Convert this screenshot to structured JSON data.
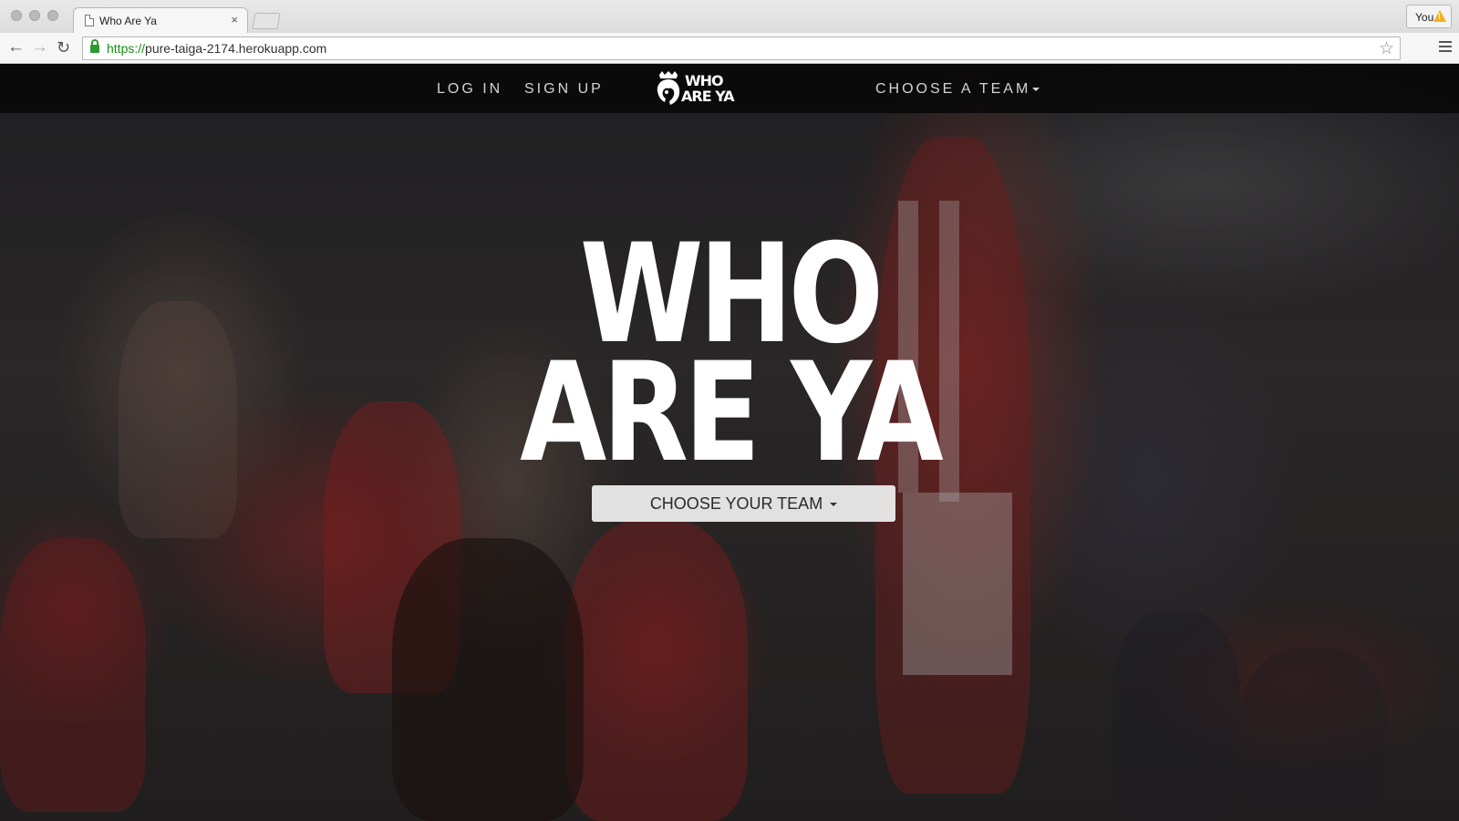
{
  "browser": {
    "tab_title": "Who Are Ya",
    "tab_close": "×",
    "profile_name": "You",
    "url_scheme": "https://",
    "url_rest": "pure-taiga-2174.herokuapp.com",
    "back_glyph": "←",
    "forward_glyph": "→",
    "reload_glyph": "↻",
    "star_glyph": "☆",
    "icons": [
      "document-icon",
      "close-icon",
      "warning-icon",
      "back-arrow-icon",
      "forward-arrow-icon",
      "reload-icon",
      "lock-icon",
      "star-icon",
      "menu-icon"
    ]
  },
  "site": {
    "nav": {
      "login": "LOG IN",
      "signup": "SIGN UP",
      "choose_team": "CHOOSE A TEAM",
      "brand_line1": "WHO",
      "brand_line2": "ARE YA"
    },
    "hero": {
      "title_line1": "WHO",
      "title_line2": "ARE YA",
      "cta": "CHOOSE YOUR TEAM"
    },
    "colors": {
      "navbar": "#080808",
      "nav_text": "#d4d4d4",
      "hero_text": "#ffffff",
      "secure_green": "#1a8f1a"
    }
  }
}
